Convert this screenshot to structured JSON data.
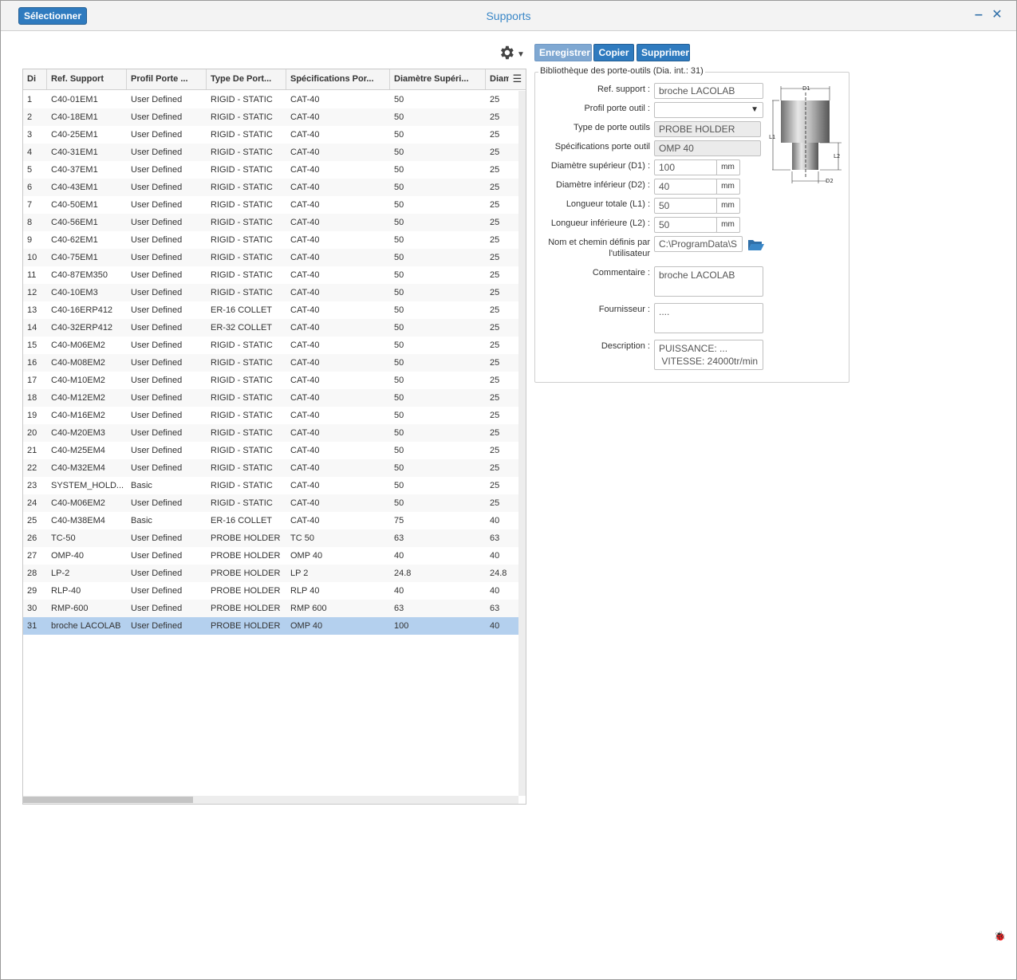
{
  "window": {
    "title": "Supports",
    "select_button": "Sélectionner",
    "minimize_glyph": "‒",
    "close_glyph": "✕"
  },
  "toolbar": {
    "save_label": "Enregistrer",
    "copy_label": "Copier",
    "delete_label": "Supprimer",
    "gear_icon": "gear-icon"
  },
  "grid": {
    "columns": [
      "Di",
      "Ref. Support",
      "Profil Porte ...",
      "Type De Port...",
      "Spécifications Por...",
      "Diamètre Supéri...",
      "Diam"
    ],
    "rows": [
      [
        "1",
        "C40-01EM1",
        "User Defined",
        "RIGID - STATIC",
        "CAT-40",
        "50",
        "25"
      ],
      [
        "2",
        "C40-18EM1",
        "User Defined",
        "RIGID - STATIC",
        "CAT-40",
        "50",
        "25"
      ],
      [
        "3",
        "C40-25EM1",
        "User Defined",
        "RIGID - STATIC",
        "CAT-40",
        "50",
        "25"
      ],
      [
        "4",
        "C40-31EM1",
        "User Defined",
        "RIGID - STATIC",
        "CAT-40",
        "50",
        "25"
      ],
      [
        "5",
        "C40-37EM1",
        "User Defined",
        "RIGID - STATIC",
        "CAT-40",
        "50",
        "25"
      ],
      [
        "6",
        "C40-43EM1",
        "User Defined",
        "RIGID - STATIC",
        "CAT-40",
        "50",
        "25"
      ],
      [
        "7",
        "C40-50EM1",
        "User Defined",
        "RIGID - STATIC",
        "CAT-40",
        "50",
        "25"
      ],
      [
        "8",
        "C40-56EM1",
        "User Defined",
        "RIGID - STATIC",
        "CAT-40",
        "50",
        "25"
      ],
      [
        "9",
        "C40-62EM1",
        "User Defined",
        "RIGID - STATIC",
        "CAT-40",
        "50",
        "25"
      ],
      [
        "10",
        "C40-75EM1",
        "User Defined",
        "RIGID - STATIC",
        "CAT-40",
        "50",
        "25"
      ],
      [
        "11",
        "C40-87EM350",
        "User Defined",
        "RIGID - STATIC",
        "CAT-40",
        "50",
        "25"
      ],
      [
        "12",
        "C40-10EM3",
        "User Defined",
        "RIGID - STATIC",
        "CAT-40",
        "50",
        "25"
      ],
      [
        "13",
        "C40-16ERP412",
        "User Defined",
        "ER-16 COLLET",
        "CAT-40",
        "50",
        "25"
      ],
      [
        "14",
        "C40-32ERP412",
        "User Defined",
        "ER-32 COLLET",
        "CAT-40",
        "50",
        "25"
      ],
      [
        "15",
        "C40-M06EM2",
        "User Defined",
        "RIGID - STATIC",
        "CAT-40",
        "50",
        "25"
      ],
      [
        "16",
        "C40-M08EM2",
        "User Defined",
        "RIGID - STATIC",
        "CAT-40",
        "50",
        "25"
      ],
      [
        "17",
        "C40-M10EM2",
        "User Defined",
        "RIGID - STATIC",
        "CAT-40",
        "50",
        "25"
      ],
      [
        "18",
        "C40-M12EM2",
        "User Defined",
        "RIGID - STATIC",
        "CAT-40",
        "50",
        "25"
      ],
      [
        "19",
        "C40-M16EM2",
        "User Defined",
        "RIGID - STATIC",
        "CAT-40",
        "50",
        "25"
      ],
      [
        "20",
        "C40-M20EM3",
        "User Defined",
        "RIGID - STATIC",
        "CAT-40",
        "50",
        "25"
      ],
      [
        "21",
        "C40-M25EM4",
        "User Defined",
        "RIGID - STATIC",
        "CAT-40",
        "50",
        "25"
      ],
      [
        "22",
        "C40-M32EM4",
        "User Defined",
        "RIGID - STATIC",
        "CAT-40",
        "50",
        "25"
      ],
      [
        "23",
        "SYSTEM_HOLD...",
        "Basic",
        "RIGID - STATIC",
        "CAT-40",
        "50",
        "25"
      ],
      [
        "24",
        "C40-M06EM2",
        "User Defined",
        "RIGID - STATIC",
        "CAT-40",
        "50",
        "25"
      ],
      [
        "25",
        "C40-M38EM4",
        "Basic",
        "ER-16 COLLET",
        "CAT-40",
        "75",
        "40"
      ],
      [
        "26",
        "TC-50",
        "User Defined",
        "PROBE HOLDER",
        "TC 50",
        "63",
        "63"
      ],
      [
        "27",
        "OMP-40",
        "User Defined",
        "PROBE HOLDER",
        "OMP 40",
        "40",
        "40"
      ],
      [
        "28",
        "LP-2",
        "User Defined",
        "PROBE HOLDER",
        "LP 2",
        "24.8",
        "24.8"
      ],
      [
        "29",
        "RLP-40",
        "User Defined",
        "PROBE HOLDER",
        "RLP 40",
        "40",
        "40"
      ],
      [
        "30",
        "RMP-600",
        "User Defined",
        "PROBE HOLDER",
        "RMP 600",
        "63",
        "63"
      ],
      [
        "31",
        "broche LACOLAB",
        "User Defined",
        "PROBE HOLDER",
        "OMP 40",
        "100",
        "40"
      ]
    ],
    "selected_row_index": 30
  },
  "form": {
    "legend": "Bibliothèque des porte-outils (Dia. int.: 31)",
    "ref_label": "Ref. support :",
    "ref_value": "broche LACOLAB",
    "profile_label": "Profil porte outil :",
    "profile_value": "",
    "type_label": "Type de porte outils",
    "type_value": "PROBE HOLDER",
    "spec_label": "Spécifications porte outil",
    "spec_value": "OMP 40",
    "d1_label": "Diamètre supérieur (D1) :",
    "d1_value": "100",
    "d2_label": "Diamètre inférieur (D2) :",
    "d2_value": "40",
    "l1_label": "Longueur totale (L1) :",
    "l1_value": "50",
    "l2_label": "Longueur inférieure (L2) :",
    "l2_value": "50",
    "unit": "mm",
    "path_label_1": "Nom et chemin définis par",
    "path_label_2": "l'utilisateur",
    "path_value": "C:\\ProgramData\\S",
    "comment_label": "Commentaire :",
    "comment_value": "broche LACOLAB",
    "supplier_label": "Fournisseur :",
    "supplier_value": "....",
    "description_label": "Description :",
    "description_value": "PUISSANCE: ...\n VITESSE: 24000tr/min"
  },
  "diagram": {
    "d1_text": "D1",
    "d2_text": "D2",
    "l1_text": "L1",
    "l2_text": "L2"
  },
  "colors": {
    "accent": "#2f7bbf",
    "title": "#3a87c7",
    "selected_row": "#b4d0ee"
  }
}
